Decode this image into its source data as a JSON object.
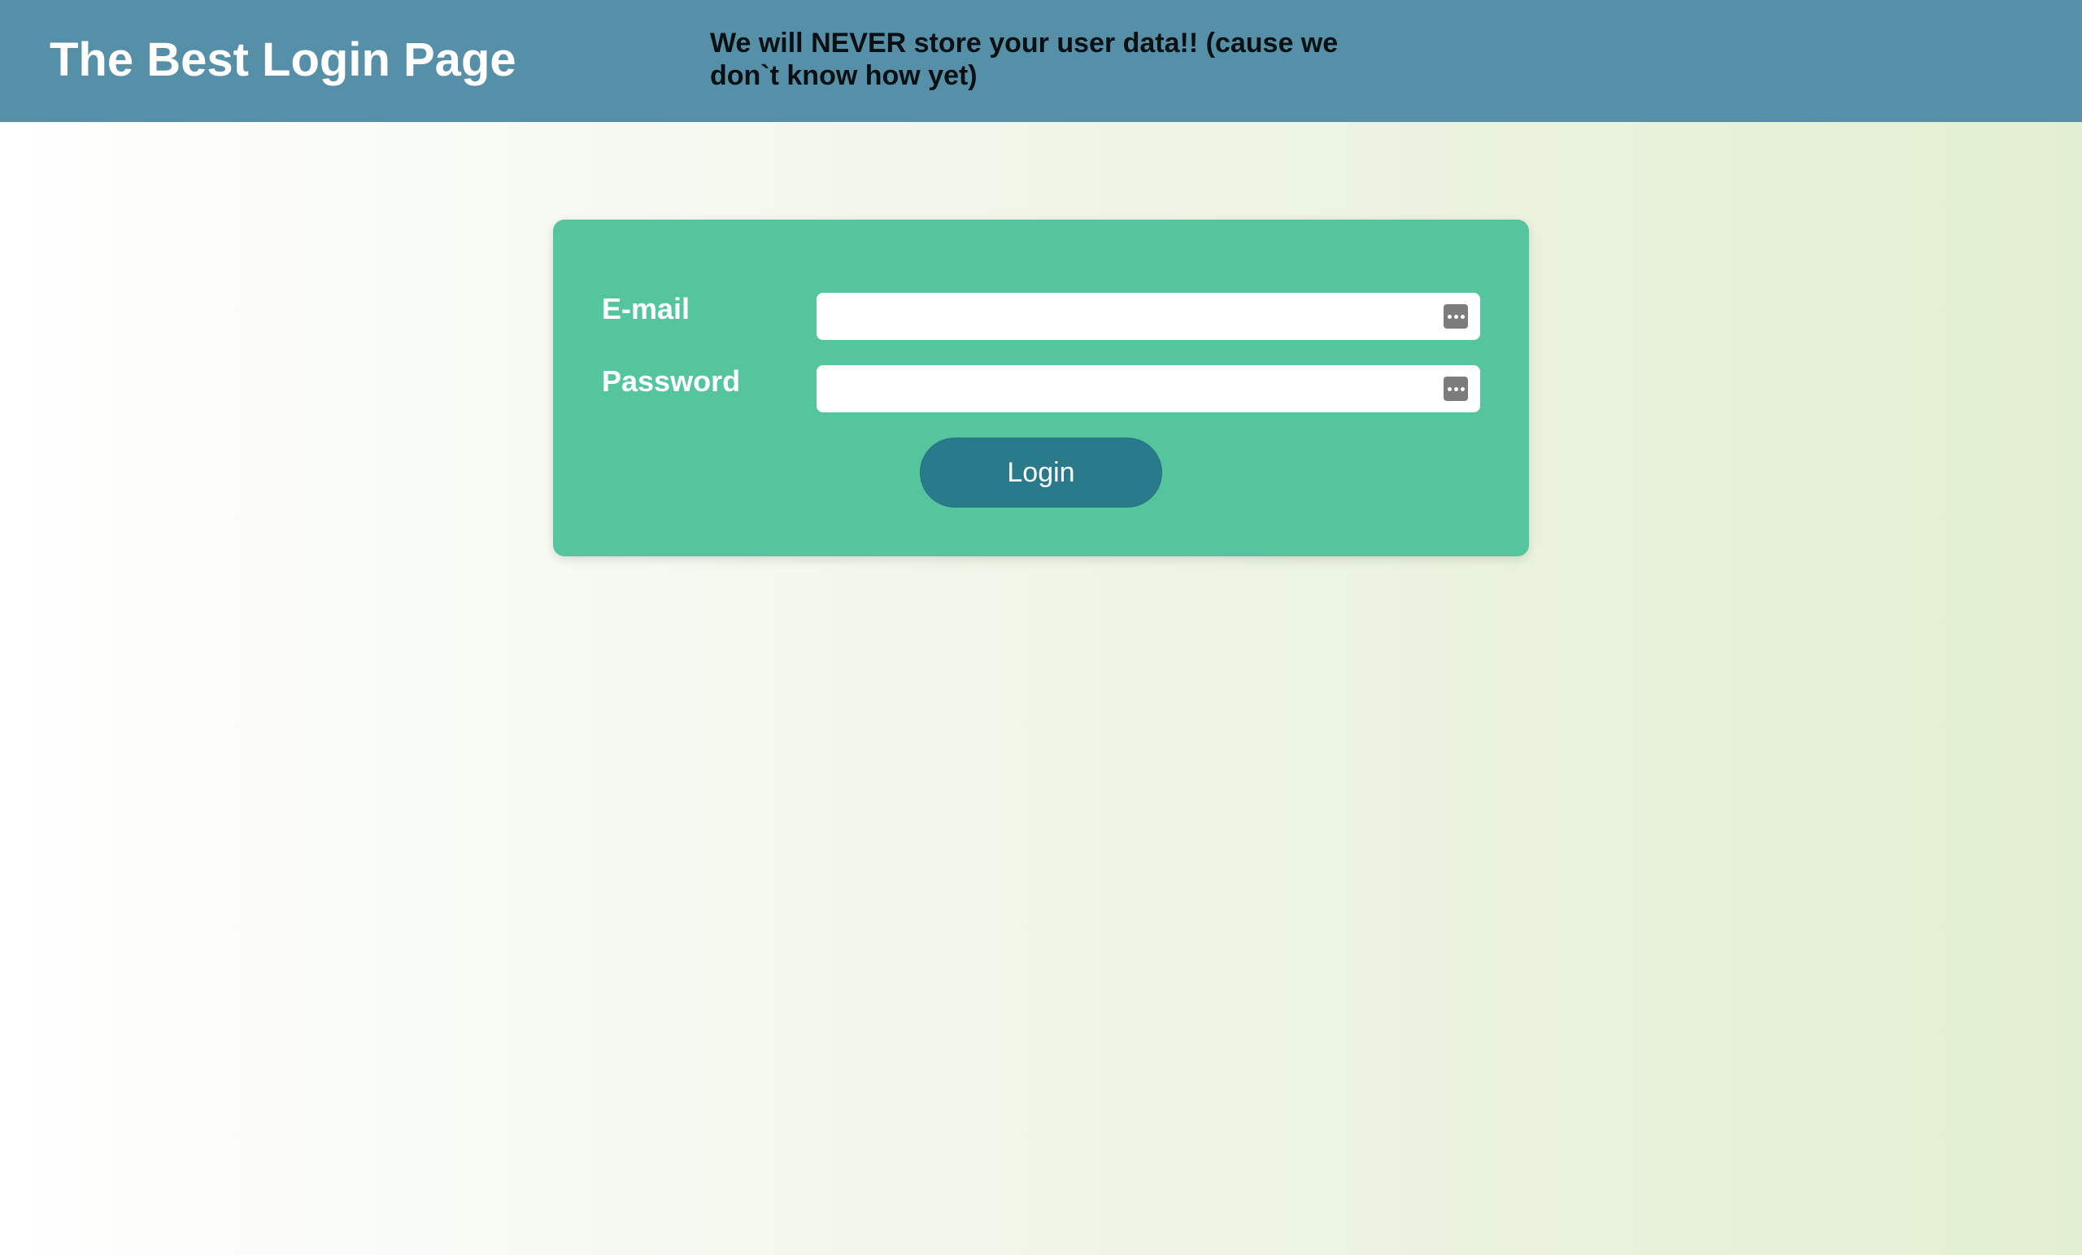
{
  "header": {
    "title": "The Best Login Page",
    "disclaimer": "We will NEVER store your user data!! (cause we don`t know how yet)"
  },
  "form": {
    "email_label": "E-mail",
    "email_value": "",
    "password_label": "Password",
    "password_value": "",
    "login_label": "Login",
    "field_icon": "password-manager-dots-icon"
  },
  "colors": {
    "header_bg": "#5690a8",
    "card_bg": "#55c59e",
    "button_bg": "#297b8c",
    "page_gradient_start": "#ffffff",
    "page_gradient_end": "#e3efd2"
  }
}
